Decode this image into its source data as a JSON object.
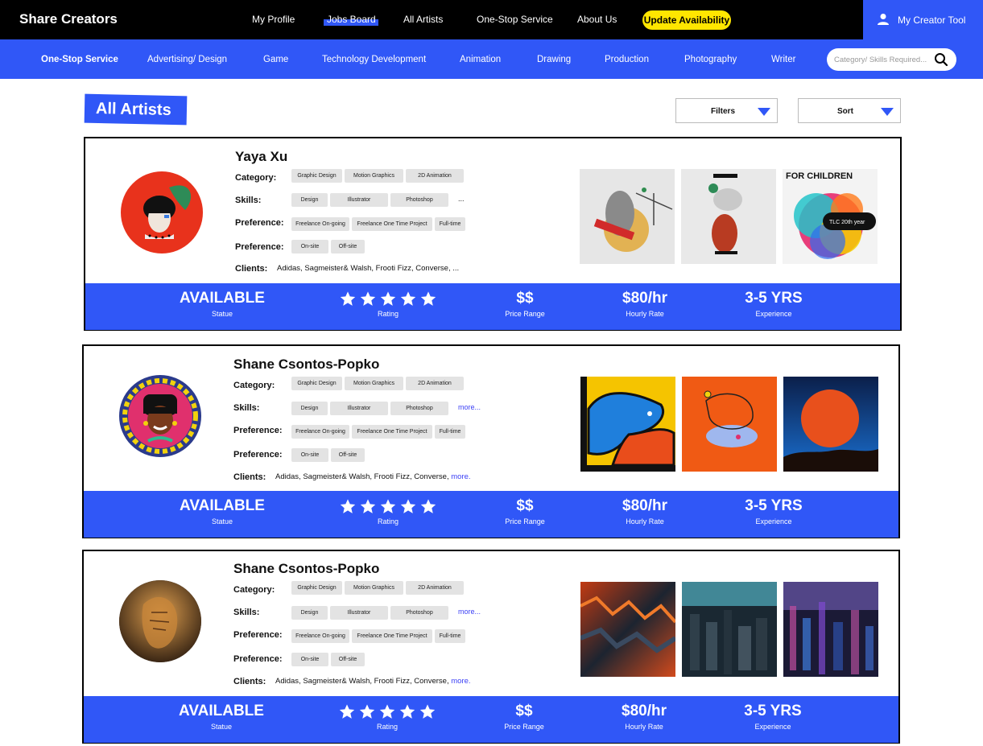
{
  "header": {
    "brand": "Share Creators",
    "nav": [
      "My Profile",
      "Jobs Board",
      "All Artists",
      "One-Stop Service",
      "About Us"
    ],
    "update_button": "Update Availability",
    "creator_tool": "My Creator Tool",
    "creator_icon": "user-icon"
  },
  "categories": [
    "One-Stop Service",
    "Advertising/ Design",
    "Game",
    "Technology Development",
    "Animation",
    "Drawing",
    "Production",
    "Photography",
    "Writer"
  ],
  "search": {
    "placeholder": "Category/ Skills Required...",
    "icon": "search-icon"
  },
  "page": {
    "title": "All Artists",
    "filters": "Filters",
    "sort": "Sort"
  },
  "labels": {
    "category": "Category:",
    "skills": "Skills:",
    "preference": "Preference:",
    "clients": "Clients:",
    "more": "more...",
    "more_short": "more.",
    "ellipsis": "..."
  },
  "stat_labels": {
    "status": "Statue",
    "rating": "Rating",
    "price": "Price Range",
    "hourly": "Hourly Rate",
    "experience": "Experience"
  },
  "artists": [
    {
      "name": "Yaya Xu",
      "categories": [
        "Graphic Design",
        "Motion Graphics",
        "2D Animation"
      ],
      "skills": [
        "Design",
        "Illustrator",
        "Photoshop"
      ],
      "preference1": [
        "Freelance On-going",
        "Freelance One Time Project",
        "Full-time"
      ],
      "preference2": [
        "On-site",
        "Off-site"
      ],
      "clients": "Adidas, Sagmeister& Walsh,  Frooti Fizz, Converse, ...",
      "status": "AVAILABLE",
      "rating": 5,
      "price": "$$",
      "hourly": "$80/hr",
      "experience": "3-5 YRS",
      "artwork_text": {
        "headline": "FOR CHILDREN",
        "badge": "TLC 20th year"
      }
    },
    {
      "name": "Shane Csontos-Popko",
      "categories": [
        "Graphic Design",
        "Motion Graphics",
        "2D Animation"
      ],
      "skills": [
        "Design",
        "Illustrator",
        "Photoshop"
      ],
      "preference1": [
        "Freelance On-going",
        "Freelance One Time Project",
        "Full-time"
      ],
      "preference2": [
        "On-site",
        "Off-site"
      ],
      "clients": "Adidas, Sagmeister& Walsh,  Frooti Fizz, Converse, ",
      "status": "AVAILABLE",
      "rating": 5,
      "price": "$$",
      "hourly": "$80/hr",
      "experience": "3-5 YRS"
    },
    {
      "name": "Shane Csontos-Popko",
      "categories": [
        "Graphic Design",
        "Motion Graphics",
        "2D Animation"
      ],
      "skills": [
        "Design",
        "Illustrator",
        "Photoshop"
      ],
      "preference1": [
        "Freelance On-going",
        "Freelance One Time Project",
        "Full-time"
      ],
      "preference2": [
        "On-site",
        "Off-site"
      ],
      "clients": "Adidas, Sagmeister& Walsh,  Frooti Fizz, Converse, ",
      "status": "AVAILABLE",
      "rating": 5,
      "price": "$$",
      "hourly": "$80/hr",
      "experience": "3-5 YRS"
    }
  ],
  "colors": {
    "brand_blue": "#3057f7",
    "accent_yellow": "#ffe600",
    "link": "#3a3ff5"
  }
}
